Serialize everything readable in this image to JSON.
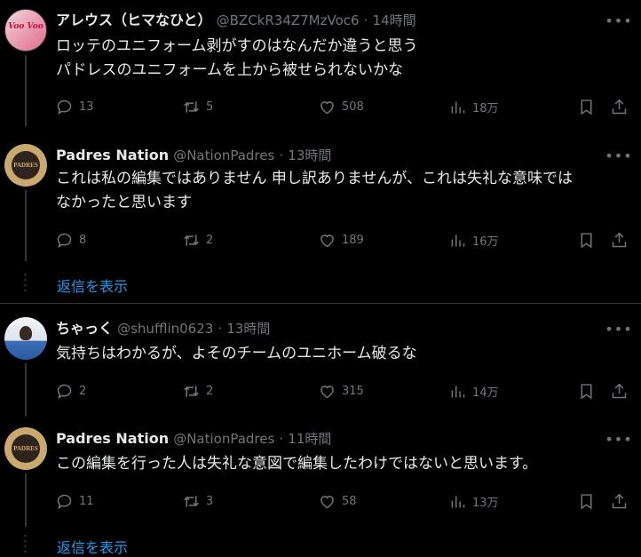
{
  "tweets": [
    {
      "name": "アレウス（ヒマなひと）",
      "handle": "@BZCkR34Z7MzVoc6",
      "time": "14時間",
      "text_lines": [
        "ロッテのユニフォーム剥がすのはなんだか違うと思う",
        "パドレスのユニフォームを上から被せられないかな"
      ],
      "replies": "13",
      "retweets": "5",
      "likes": "508",
      "views": "18万",
      "avatar_text": "Voo Voo"
    },
    {
      "name": "Padres Nation",
      "handle": "@NationPadres",
      "time": "13時間",
      "text_lines": [
        "これは私の編集ではありません 申し訳ありませんが、これは失礼な意味では",
        "なかったと思います"
      ],
      "replies": "8",
      "retweets": "2",
      "likes": "189",
      "views": "16万",
      "avatar_text": "PADRES"
    },
    {
      "name": "ちゃっく",
      "handle": "@shufflin0623",
      "time": "13時間",
      "text_lines": [
        "気持ちはわかるが、よそのチームのユニホーム破るな"
      ],
      "replies": "2",
      "retweets": "2",
      "likes": "315",
      "views": "14万"
    },
    {
      "name": "Padres Nation",
      "handle": "@NationPadres",
      "time": "11時間",
      "text_lines": [
        "この編集を行った人は失礼な意図で編集したわけではないと思います。"
      ],
      "replies": "11",
      "retweets": "3",
      "likes": "58",
      "views": "13万",
      "avatar_text": "PADRES"
    }
  ],
  "dot_sep": "·",
  "show_replies": "返信を表示",
  "colors": {
    "background": "#000000",
    "text": "#e7e9ea",
    "muted": "#71767b",
    "link": "#1d9bf0",
    "divider": "#2f3336",
    "padres_brown": "#2f241d",
    "padres_gold": "#c9a970"
  }
}
